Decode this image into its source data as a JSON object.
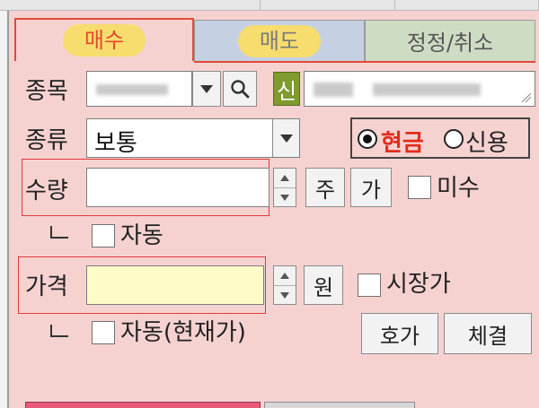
{
  "tabs": [
    {
      "label": "매수"
    },
    {
      "label": "매도"
    },
    {
      "label": "정정/취소"
    }
  ],
  "stock": {
    "label": "종목",
    "badge": "신"
  },
  "kind": {
    "label": "종류",
    "value": "보통",
    "cash": "현금",
    "credit": "신용"
  },
  "qty": {
    "label": "수량",
    "unit": "주",
    "avail": "가",
    "misu": "미수",
    "auto": "자동"
  },
  "price": {
    "label": "가격",
    "unit": "원",
    "market": "시장가",
    "auto": "자동(현재가)",
    "quote_btn": "호가",
    "exec_btn": "체결"
  }
}
